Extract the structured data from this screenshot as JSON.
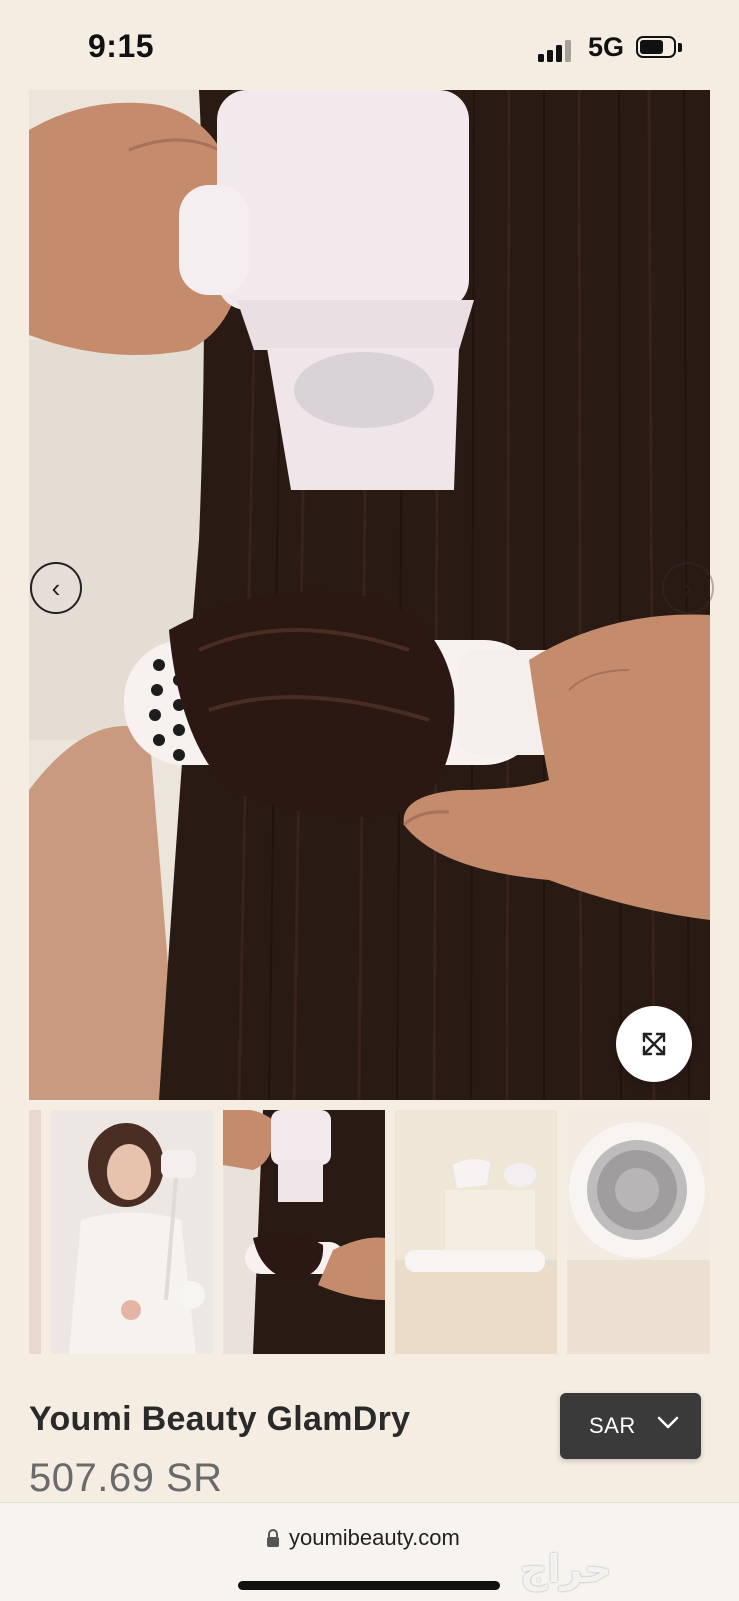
{
  "status_bar": {
    "time": "9:15",
    "network": "5G"
  },
  "gallery": {
    "hero_alt": "hand holding hair dryer and round brush on long dark hair",
    "prev_icon": "chevron-left-icon",
    "next_icon": "chevron-right-icon",
    "expand_icon": "expand-icon"
  },
  "product": {
    "title": "Youmi Beauty GlamDry",
    "price": "507.69 SR"
  },
  "currency": {
    "selected": "SAR",
    "icon": "chevron-down-icon"
  },
  "browser": {
    "url": "youmibeauty.com"
  },
  "watermark": {
    "text": "حراج"
  },
  "colors": {
    "page_bg": "#f6ede2",
    "button_bg": "#3a3a3a",
    "price": "#6a6a6a"
  }
}
